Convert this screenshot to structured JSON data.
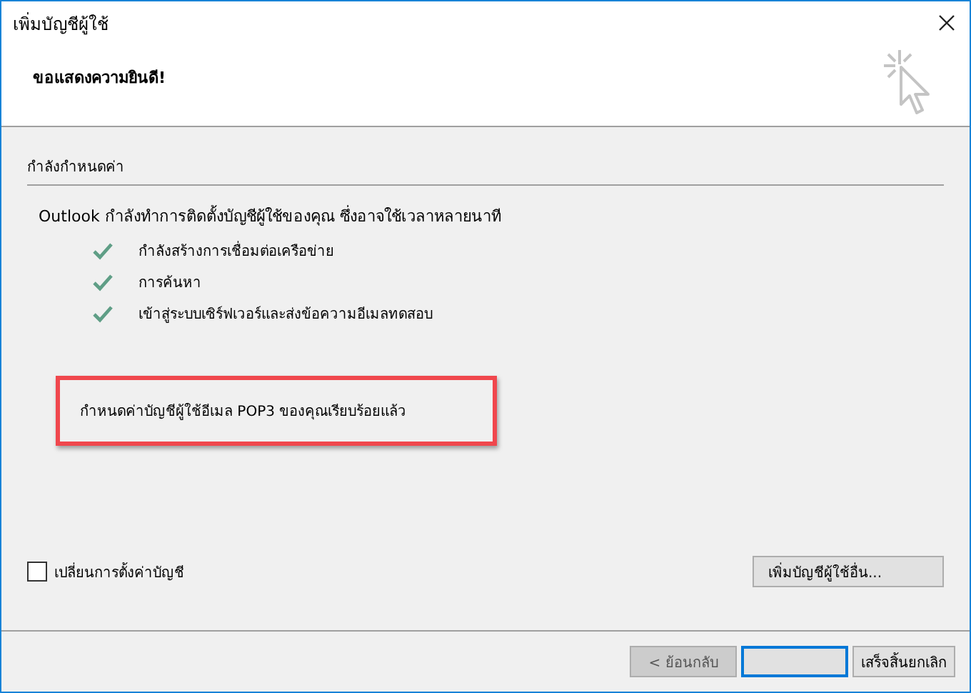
{
  "window": {
    "title": "เพิ่มบัญชีผู้ใช้"
  },
  "header": {
    "heading": "ขอแสดงความยินดี!"
  },
  "section": {
    "title": "กำลังกำหนดค่า",
    "intro": "Outlook กำลังทำการติดตั้งบัญชีผู้ใช้ของคุณ ซึ่งอาจใช้เวลาหลายนาที",
    "steps": [
      {
        "label": "กำลังสร้างการเชื่อมต่อเครือข่าย",
        "done": true
      },
      {
        "label": "การค้นหา",
        "done": true
      },
      {
        "label": "เข้าสู่ระบบเซิร์ฟเวอร์และส่งข้อความอีเมลทดสอบ",
        "done": true
      }
    ],
    "result": {
      "text": "กำหนดค่าบัญชีผู้ใช้อีเมล POP3 ของคุณเรียบร้อยแล้ว",
      "highlighted": true
    }
  },
  "change_settings": {
    "label": "เปลี่ยนการตั้งค่าบัญชี",
    "checked": false
  },
  "add_another": {
    "label": "เพิ่มบัญชีผู้ใช้อื่น..."
  },
  "buttons": [
    {
      "kind": "back",
      "label": "< ย้อนกลับ",
      "disabled": true,
      "focused": false
    },
    {
      "kind": "blank",
      "disabled": false,
      "focused": true
    },
    {
      "kind": "cancel",
      "label": "เสร็จสิ้นยกเลิก",
      "disabled": false,
      "focused": false
    }
  ]
}
